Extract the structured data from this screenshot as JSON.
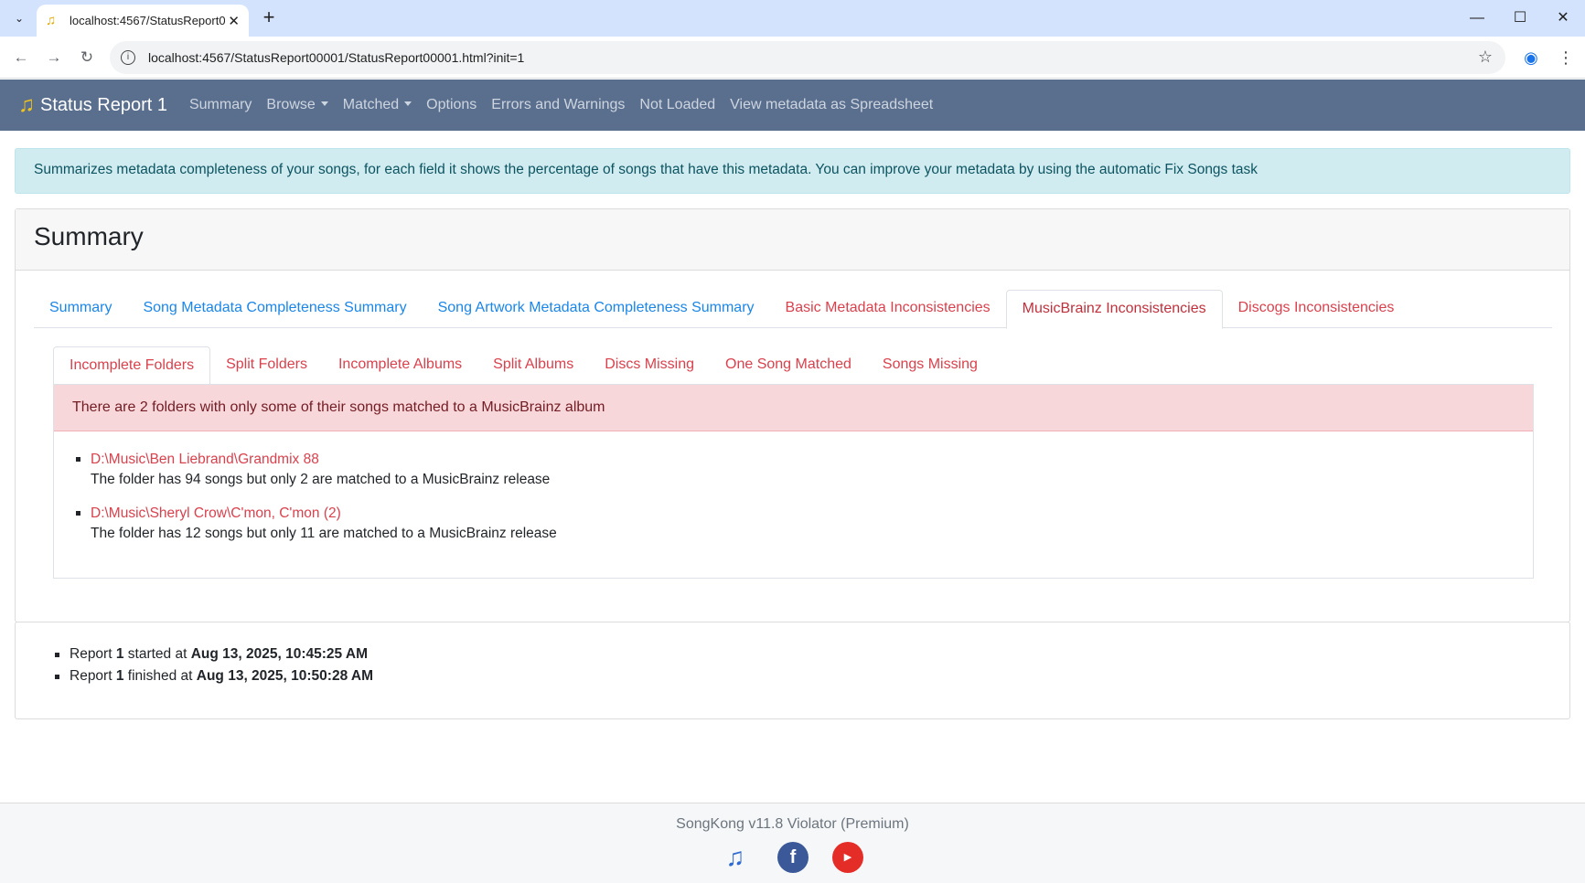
{
  "browser": {
    "tab_title": "localhost:4567/StatusReport00001",
    "url": "localhost:4567/StatusReport00001/StatusReport00001.html?init=1",
    "new_tab": "+",
    "minimize": "—",
    "maximize": "☐",
    "close": "✕"
  },
  "navbar": {
    "brand": "Status Report 1",
    "links": [
      "Summary",
      "Browse",
      "Matched",
      "Options",
      "Errors and Warnings",
      "Not Loaded",
      "View metadata as Spreadsheet"
    ]
  },
  "info_alert": "Summarizes metadata completeness of your songs, for each field it shows the percentage of songs that have this metadata. You can improve your metadata by using the automatic Fix Songs task",
  "summary": {
    "title": "Summary",
    "tabs": [
      "Summary",
      "Song Metadata Completeness Summary",
      "Song Artwork Metadata Completeness Summary",
      "Basic Metadata Inconsistencies",
      "MusicBrainz Inconsistencies",
      "Discogs Inconsistencies"
    ],
    "subtabs": [
      "Incomplete Folders",
      "Split Folders",
      "Incomplete Albums",
      "Split Albums",
      "Discs Missing",
      "One Song Matched",
      "Songs Missing"
    ],
    "alert": "There are 2 folders with only some of their songs matched to a MusicBrainz album",
    "folders": [
      {
        "path": "D:\\Music\\Ben Liebrand\\Grandmix 88",
        "desc": "The folder has 94 songs but only 2 are matched to a MusicBrainz release"
      },
      {
        "path": "D:\\Music\\Sheryl Crow\\C'mon, C'mon (2)",
        "desc": "The folder has 12 songs but only 11 are matched to a MusicBrainz release"
      }
    ]
  },
  "report_times": {
    "started_prefix": "Report",
    "report_num": "1",
    "started_label": "started at",
    "started_time": "Aug 13, 2025, 10:45:25 AM",
    "finished_label": "finished at",
    "finished_time": "Aug 13, 2025, 10:50:28 AM"
  },
  "footer": {
    "text": "SongKong v11.8 Violator (Premium)",
    "icons": [
      "songkong-icon",
      "facebook-icon",
      "youtube-icon"
    ]
  },
  "colors": {
    "navbar": "#5a6e8d",
    "link_blue": "#1a86e8",
    "link_red": "#d9414d",
    "info_bg": "#d1ecf1",
    "danger_bg": "#f8d7da"
  }
}
